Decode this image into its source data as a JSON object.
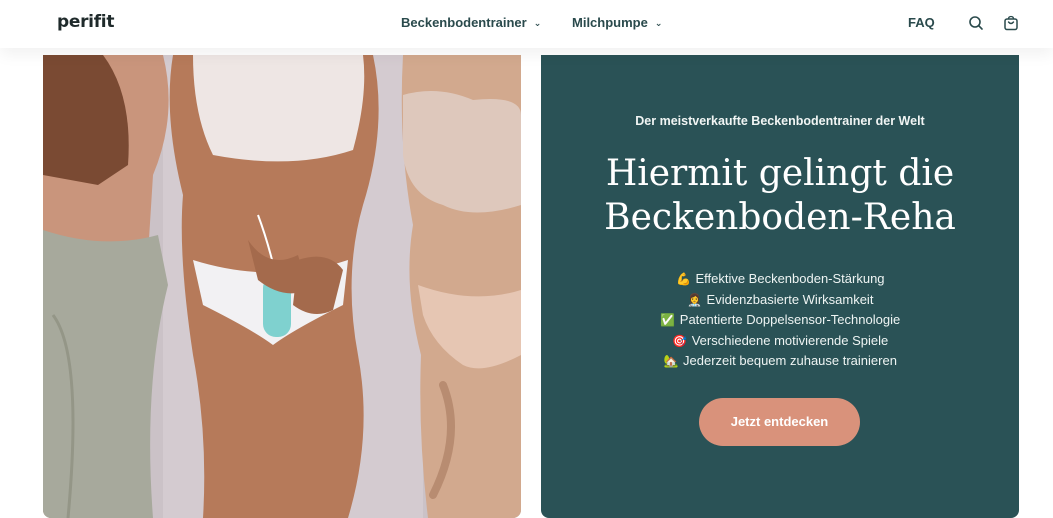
{
  "header": {
    "logo": "perifit",
    "nav": [
      {
        "label": "Beckenbodentrainer"
      },
      {
        "label": "Milchpumpe"
      }
    ],
    "faq_label": "FAQ",
    "icons": [
      "search-icon",
      "cart-icon",
      "chevron-down-icon"
    ]
  },
  "hero": {
    "eyebrow": "Der meistverkaufte Beckenbodentrainer der Welt",
    "title_line1": "Hiermit gelingt die",
    "title_line2": "Beckenboden-Reha",
    "features": [
      {
        "emoji": "💪",
        "text": "Effektive Beckenboden-Stärkung"
      },
      {
        "emoji": "👩‍⚕️",
        "text": "Evidenzbasierte Wirksamkeit"
      },
      {
        "emoji": "✅",
        "text": "Patentierte Doppelsensor-Technologie"
      },
      {
        "emoji": "🎯",
        "text": "Verschiedene motivierende Spiele"
      },
      {
        "emoji": "🏡",
        "text": "Jederzeit bequem zuhause trainieren"
      }
    ],
    "cta_label": "Jetzt entdecken"
  },
  "colors": {
    "panel_bg": "#2a5256",
    "cta_bg": "#d9927b",
    "nav_text": "#2a4a4c",
    "logo_text": "#1f2a2b"
  }
}
